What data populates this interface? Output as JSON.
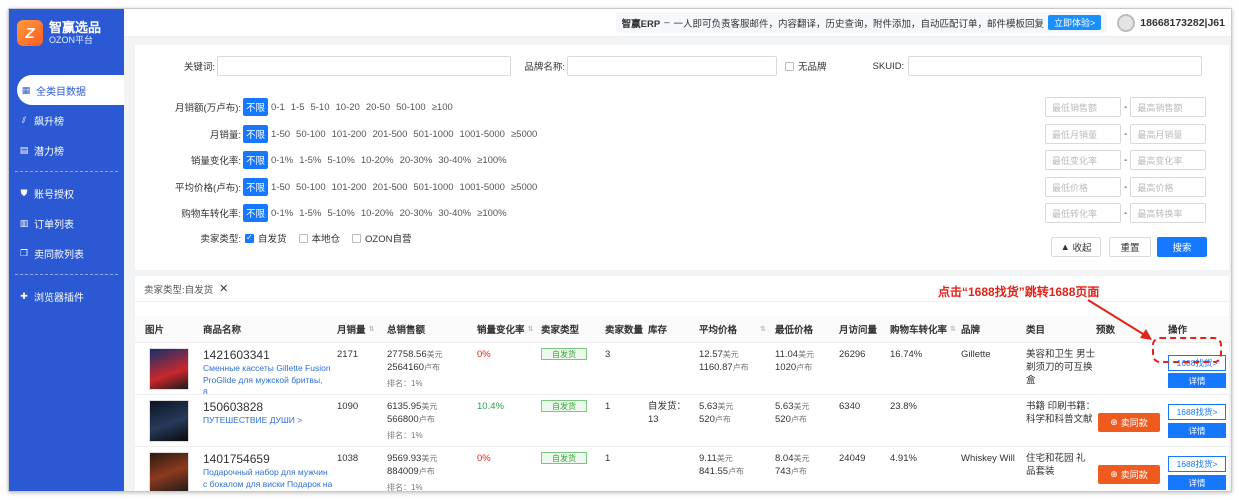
{
  "brand": {
    "name": "智赢选品",
    "sub": "OZON平台"
  },
  "sidebar": {
    "items": [
      {
        "label": "全类目数据",
        "icon": "grid-icon"
      },
      {
        "label": "飙升榜",
        "icon": "chart-icon"
      },
      {
        "label": "潜力榜",
        "icon": "list-icon"
      },
      {
        "label": "账号授权",
        "icon": "shield-icon"
      },
      {
        "label": "订单列表",
        "icon": "document-icon"
      },
      {
        "label": "卖同款列表",
        "icon": "copy-icon"
      },
      {
        "label": "浏览器插件",
        "icon": "puzzle-icon"
      }
    ]
  },
  "topbar": {
    "promo_title": "智赢ERP",
    "promo_text": "一人即可负责客服邮件，内容翻译，历史查询，附件添加，自动匹配订单，邮件模板回复",
    "promo_btn": "立即体验>",
    "user": "18668173282|J61"
  },
  "filters": {
    "keyword_label": "关键词:",
    "brand_label": "品牌名称:",
    "no_brand_label": "无品牌",
    "sku_label": "SKUID:",
    "rows": [
      {
        "label": "月销额(万卢布):",
        "options": [
          "不限",
          "0-1",
          "1-5",
          "5-10",
          "10-20",
          "20-50",
          "50-100",
          "≥100"
        ],
        "min": "最低销售额",
        "max": "最高销售额"
      },
      {
        "label": "月销量:",
        "options": [
          "不限",
          "1-50",
          "50-100",
          "101-200",
          "201-500",
          "501-1000",
          "1001-5000",
          "≥5000"
        ],
        "min": "最低月销量",
        "max": "最高月销量"
      },
      {
        "label": "销量变化率:",
        "options": [
          "不限",
          "0-1%",
          "1-5%",
          "5-10%",
          "10-20%",
          "20-30%",
          "30-40%",
          "≥100%"
        ],
        "min": "最低变化率",
        "max": "最高变化率"
      },
      {
        "label": "平均价格(卢布):",
        "options": [
          "不限",
          "1-50",
          "50-100",
          "101-200",
          "201-500",
          "501-1000",
          "1001-5000",
          "≥5000"
        ],
        "min": "最低价格",
        "max": "最高价格"
      },
      {
        "label": "购物车转化率:",
        "options": [
          "不限",
          "0-1%",
          "1-5%",
          "5-10%",
          "10-20%",
          "20-30%",
          "30-40%",
          "≥100%"
        ],
        "min": "最低转化率",
        "max": "最高转换率"
      }
    ],
    "seller_type_label": "卖家类型:",
    "seller_types": [
      "自发货",
      "本地仓",
      "OZON自营"
    ],
    "collapse": "收起",
    "reset": "重置",
    "search": "搜索"
  },
  "results": {
    "tag_prefix": "卖家类型:",
    "tag_value": "自发货",
    "headers": [
      "图片",
      "商品名称",
      "月销量",
      "总销售额",
      "销量变化率",
      "卖家类型",
      "卖家数量",
      "库存",
      "平均价格",
      "最低价格",
      "月访问量",
      "购物车转化率",
      "品牌",
      "类目",
      "预数",
      "操作"
    ],
    "rows": [
      {
        "id": "1421603341",
        "name": "Сменные кассеты Gillette Fusion ProGlide для мужской бритвы, 8...",
        "monthly": "2171",
        "total_usd": "27758.56",
        "total_rub": "2564160",
        "rank": "排名：1%",
        "change": "0%",
        "seller_type": "自发货",
        "sellers": "3",
        "stock": "",
        "avg_usd": "12.57",
        "avg_rub": "1160.87",
        "min_usd": "11.04",
        "min_rub": "1020",
        "visits": "26296",
        "cart": "16.74%",
        "brand": "Gillette",
        "category": "美容和卫生 男士剃须刀的可互换盒",
        "has_similar": false
      },
      {
        "id": "150603828",
        "name": "ПУТЕШЕСТВИЕ ДУШИ >",
        "monthly": "1090",
        "total_usd": "6135.95",
        "total_rub": "566800",
        "rank": "排名：1%",
        "change": "10.4%",
        "seller_type": "自发货",
        "sellers": "1",
        "stock": "自发货：13",
        "avg_usd": "5.63",
        "avg_rub": "520",
        "min_usd": "5.63",
        "min_rub": "520",
        "visits": "6340",
        "cart": "23.8%",
        "brand": "",
        "category": "书籍 印刷书籍：科学和科普文献",
        "has_similar": true
      },
      {
        "id": "1401754659",
        "name": "Подарочный набор для мужчин с бокалом для виски Подарок на 2...",
        "monthly": "1038",
        "total_usd": "9569.93",
        "total_rub": "884009",
        "rank": "排名：1%",
        "change": "0%",
        "seller_type": "自发货",
        "sellers": "1",
        "stock": "",
        "avg_usd": "9.11",
        "avg_rub": "841.55",
        "min_usd": "8.04",
        "min_rub": "743",
        "visits": "24049",
        "cart": "4.91%",
        "brand": "Whiskey Will",
        "category": "住宅和花园 礼品套装",
        "has_similar": true
      }
    ],
    "unit_usd": "美元",
    "unit_rub": "卢布",
    "btn_1688": "1688找货>",
    "btn_detail": "详情",
    "btn_similar": "卖同款"
  },
  "annotation": "点击“1688找货”跳转1688页面",
  "colors": {
    "sidebar": "#2b59d4",
    "primary": "#1677ff",
    "accent": "#ef5a1f",
    "annotation": "#e2231a"
  }
}
